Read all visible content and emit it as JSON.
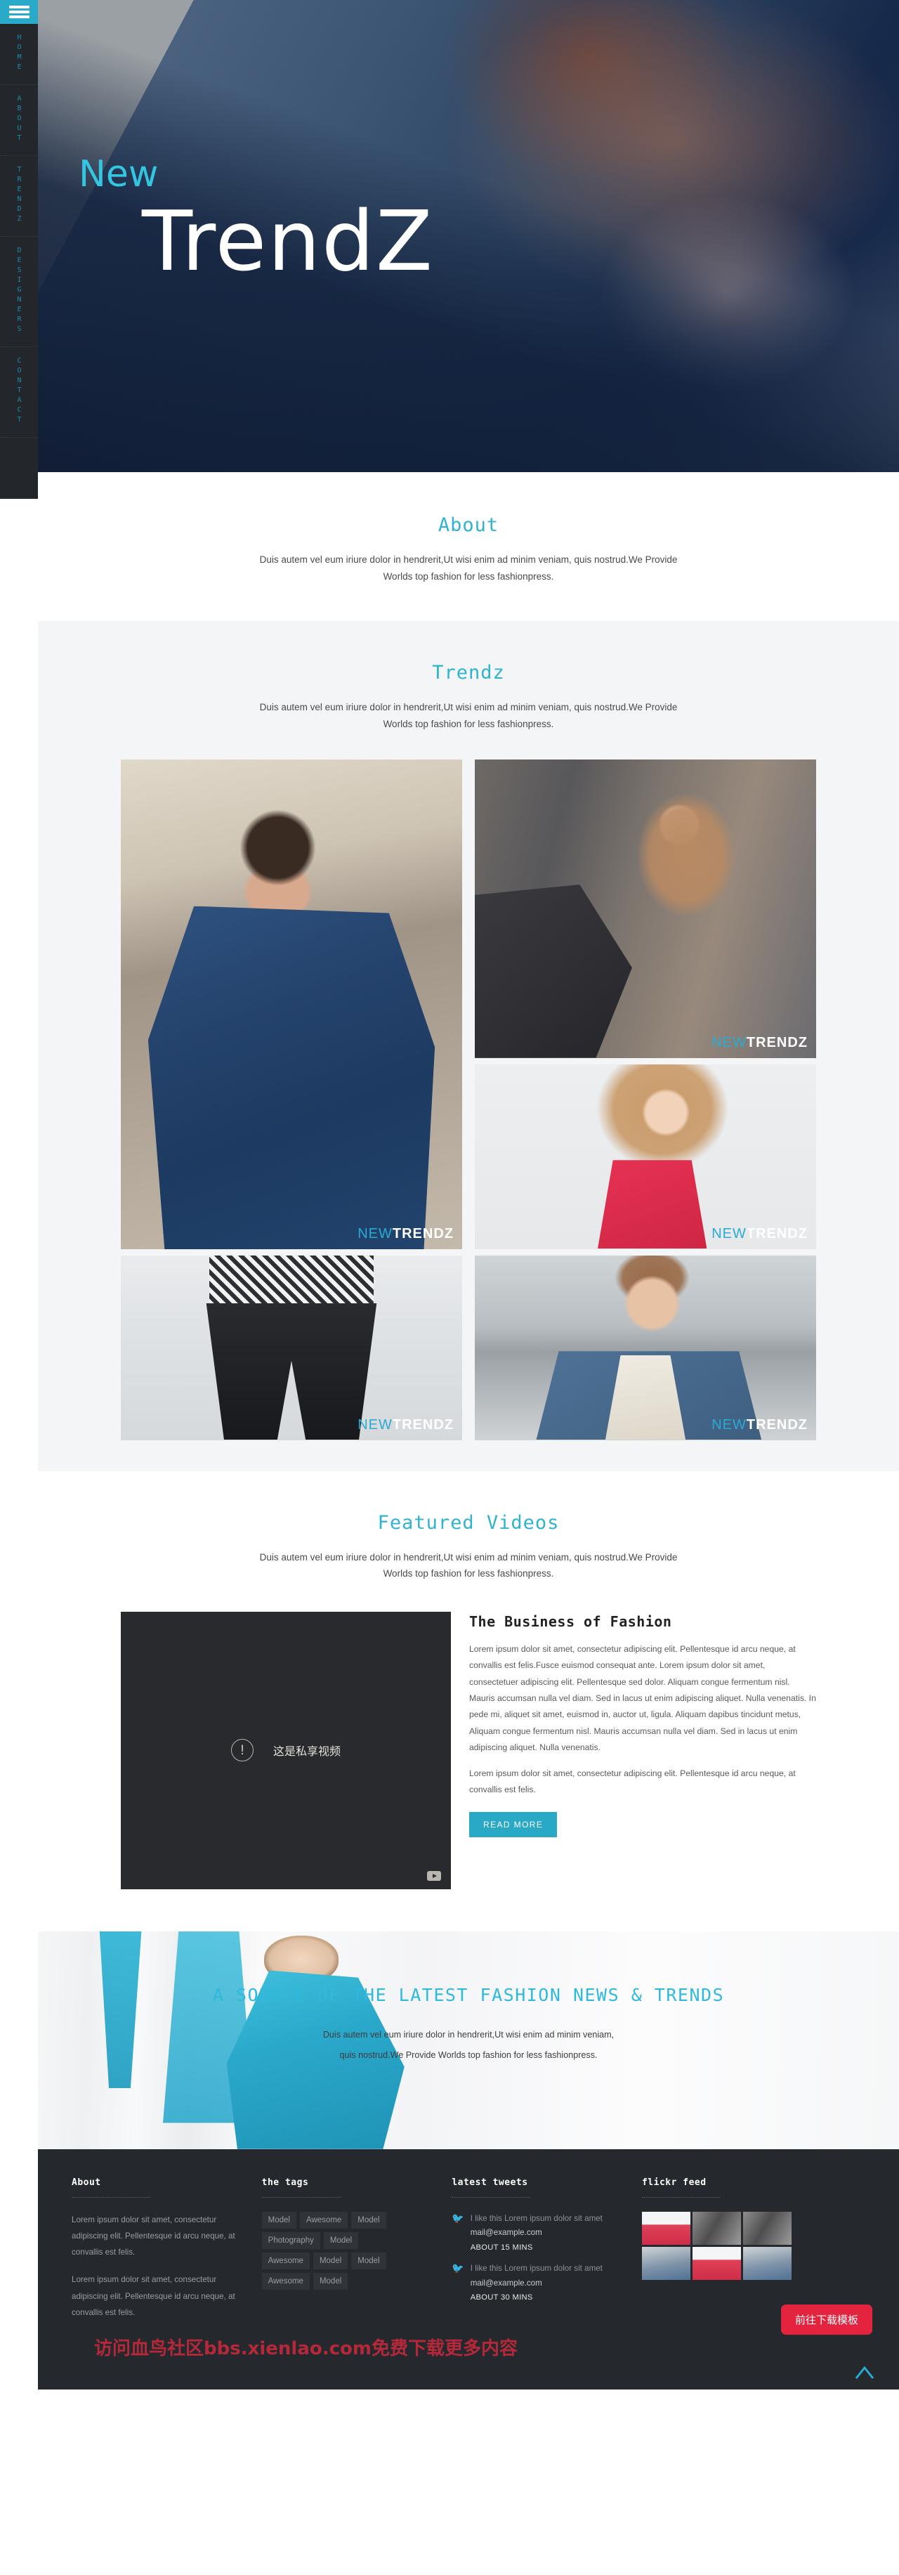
{
  "sidebar": {
    "toggle_label": "menu",
    "items": [
      {
        "label": "HOME"
      },
      {
        "label": "ABOUT"
      },
      {
        "label": "TRENDZ"
      },
      {
        "label": "DESIGNERS"
      },
      {
        "label": "CONTACT"
      }
    ]
  },
  "hero": {
    "eyebrow": "New",
    "title": "TrendZ"
  },
  "about": {
    "title": "About",
    "paragraph": "Duis autem vel eum iriure dolor in hendrerit,Ut wisi enim ad minim veniam, quis nostrud.We Provide Worlds top fashion for less fashionpress."
  },
  "trendz": {
    "title": "Trendz",
    "paragraph": "Duis autem vel eum iriure dolor in hendrerit,Ut wisi enim ad minim veniam, quis nostrud.We Provide Worlds top fashion for less fashionpress.",
    "gallery": [
      {
        "overlay_new": "NEW",
        "overlay_brand": "TRENDZ",
        "alt": "man-in-blue-suit"
      },
      {
        "overlay_new": "NEW",
        "overlay_brand": "TRENDZ",
        "alt": "woman-in-leather-jacket-sunglasses"
      },
      {
        "overlay_new": "NEW",
        "overlay_brand": "TRENDZ",
        "alt": "woman-in-red-top"
      },
      {
        "overlay_new": "NEW",
        "overlay_brand": "TRENDZ",
        "alt": "man-in-black-jeans"
      },
      {
        "overlay_new": "NEW",
        "overlay_brand": "TRENDZ",
        "alt": "man-in-denim-jacket-scarf"
      }
    ]
  },
  "videos": {
    "title": "Featured Videos",
    "paragraph": "Duis autem vel eum iriure dolor in hendrerit,Ut wisi enim ad minim veniam, quis nostrud.We Provide Worlds top fashion for less fashionpress.",
    "player": {
      "message": "这是私享视频",
      "warn_glyph": "!",
      "play_button_label": "play"
    },
    "article": {
      "title": "The Business of Fashion",
      "paragraph_1": "Lorem ipsum dolor sit amet, consectetur adipiscing elit. Pellentesque id arcu neque, at convallis est felis.Fusce euismod consequat ante. Lorem ipsum dolor sit amet, consectetuer adipiscing elit. Pellentesque sed dolor. Aliquam congue fermentum nisl. Mauris accumsan nulla vel diam. Sed in lacus ut enim adipiscing aliquet. Nulla venenatis. In pede mi, aliquet sit amet, euismod in, auctor ut, ligula. Aliquam dapibus tincidunt metus, Aliquam congue fermentum nisl. Mauris accumsan nulla vel diam. Sed in lacus ut enim adipiscing aliquet. Nulla venenatis.",
      "paragraph_2": "Lorem ipsum dolor sit amet, consectetur adipiscing elit. Pellentesque id arcu neque, at convallis est felis.",
      "button_label": "READ MORE"
    }
  },
  "parallax": {
    "title": "A SOURCE OF THE LATEST FASHION NEWS & TRENDS",
    "paragraph": "Duis autem vel eum iriure dolor in hendrerit,Ut wisi enim ad minim veniam, quis nostrud.We Provide Worlds top fashion for less fashionpress."
  },
  "footer": {
    "about": {
      "title": "About",
      "paragraph_1": "Lorem ipsum dolor sit amet, consectetur adipiscing elit. Pellentesque id arcu neque, at convallis est felis.",
      "paragraph_2": "Lorem ipsum dolor sit amet, consectetur adipiscing elit. Pellentesque id arcu neque, at convallis est felis."
    },
    "tags": {
      "title": "the tags",
      "items": [
        "Model",
        "Awesome",
        "Model",
        "Photography",
        "Model",
        "Awesome",
        "Model",
        "Model",
        "Awesome",
        "Model"
      ]
    },
    "tweets": {
      "title": "latest tweets",
      "items": [
        {
          "text": "I like this Lorem ipsum dolor sit amet",
          "mail": "mail@example.com",
          "time": "ABOUT 15 MINS"
        },
        {
          "text": "I like this Lorem ipsum dolor sit amet",
          "mail": "mail@example.com",
          "time": "ABOUT 30 MINS"
        }
      ]
    },
    "flickr": {
      "title": "flickr feed",
      "thumbs": [
        "woman-red-top",
        "woman-sunglasses-bw",
        "woman-sunglasses-bw",
        "man-denim-scarf",
        "woman-red-top",
        "man-denim-scarf"
      ]
    }
  },
  "overlays": {
    "download_button": "前往下载模板",
    "watermark": "访问血鸟社区bbs.xienlao.com免费下载更多内容",
    "to_top_label": "back-to-top"
  },
  "colors": {
    "accent": "#29aac8",
    "accent_light": "#34c6e0",
    "dark": "#25282c",
    "red": "#e4243f"
  }
}
